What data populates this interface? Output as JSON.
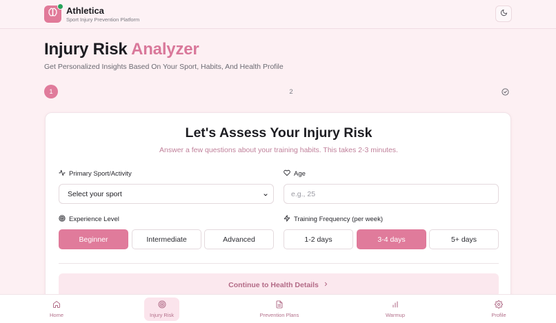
{
  "header": {
    "brand_name": "Athletica",
    "brand_sub": "Sport Injury Prevention Platform",
    "theme_icon": "moon-icon"
  },
  "page": {
    "title_main": "Injury Risk",
    "title_accent": "Analyzer",
    "subtitle": "Get Personalized Insights Based On Your Sport, Habits, And Health Profile"
  },
  "stepper": {
    "step1": "1",
    "step2": "2",
    "step3_icon": "check-circle-icon"
  },
  "card": {
    "title": "Let's Assess Your Injury Risk",
    "subtitle": "Answer a few questions about your training habits. This takes 2-3 minutes.",
    "sport_label": "Primary Sport/Activity",
    "sport_value": "Select your sport",
    "age_label": "Age",
    "age_placeholder": "e.g., 25",
    "experience_label": "Experience Level",
    "experience_options": [
      "Beginner",
      "Intermediate",
      "Advanced"
    ],
    "experience_selected": "Beginner",
    "frequency_label": "Training Frequency (per week)",
    "frequency_options": [
      "1-2 days",
      "3-4 days",
      "5+ days"
    ],
    "frequency_selected": "3-4 days",
    "continue_label": "Continue to Health Details"
  },
  "nav": {
    "items": [
      {
        "label": "Home",
        "icon": "home-icon"
      },
      {
        "label": "Injury Risk",
        "icon": "target-icon"
      },
      {
        "label": "Prevention Plans",
        "icon": "document-icon"
      },
      {
        "label": "Warmup",
        "icon": "bar-chart-icon"
      },
      {
        "label": "Profile",
        "icon": "gear-icon"
      }
    ],
    "active": "Injury Risk"
  },
  "colors": {
    "accent": "#e07b9b",
    "background": "#fdf0f3",
    "success_dot": "#27a35a"
  }
}
